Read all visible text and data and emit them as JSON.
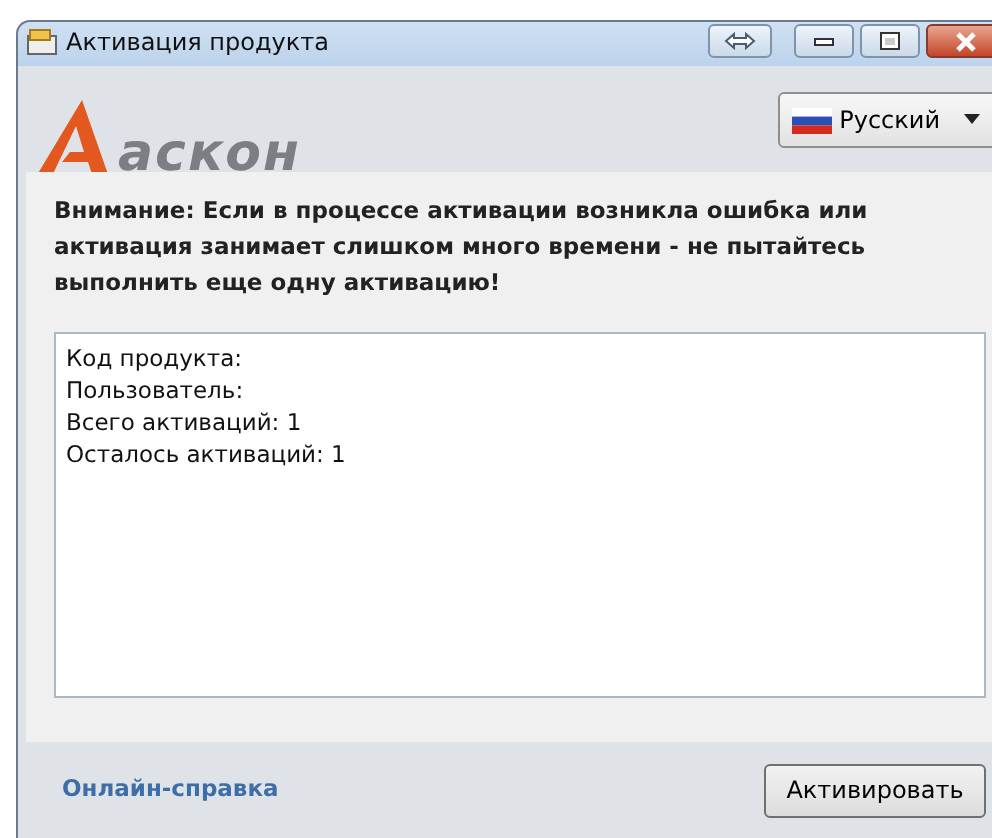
{
  "window": {
    "title": "Активация продукта"
  },
  "logo": {
    "text": "аскон"
  },
  "language": {
    "label": "Русский"
  },
  "warning": "Внимание: Если в процессе активации возникла ошибка или активация занимает слишком много времени - не пытайтесь выполнить еще одну активацию!",
  "info_lines": [
    "Код продукта:",
    "Пользователь:",
    "Всего активаций: 1",
    "Осталось активаций: 1"
  ],
  "footer": {
    "help_link": "Онлайн-справка",
    "activate_button": "Активировать"
  }
}
